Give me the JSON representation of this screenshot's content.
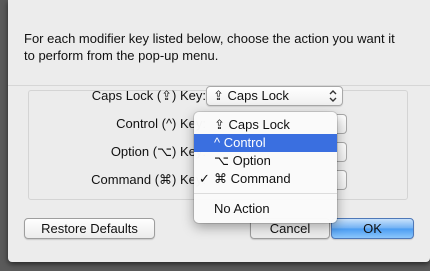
{
  "instructions": "For each modifier key listed below, choose the action you want it to perform from the pop-up menu.",
  "rows": [
    {
      "label": "Caps Lock (⇪) Key:",
      "value": "⇪ Caps Lock"
    },
    {
      "label": "Control (^) Key:"
    },
    {
      "label": "Option (⌥) Key:"
    },
    {
      "label": "Command (⌘) Key:"
    }
  ],
  "menu": {
    "items": [
      {
        "label": "⇪ Caps Lock",
        "selected": false,
        "checked": false
      },
      {
        "label": "^ Control",
        "selected": true,
        "checked": false
      },
      {
        "label": "⌥ Option",
        "selected": false,
        "checked": false
      },
      {
        "label": "⌘ Command",
        "selected": false,
        "checked": true
      }
    ],
    "check_mark": "✓",
    "no_action": "No Action",
    "highlight_color": "#3a6fe0"
  },
  "buttons": {
    "restore_defaults": "Restore Defaults",
    "cancel": "Cancel",
    "ok": "OK"
  }
}
